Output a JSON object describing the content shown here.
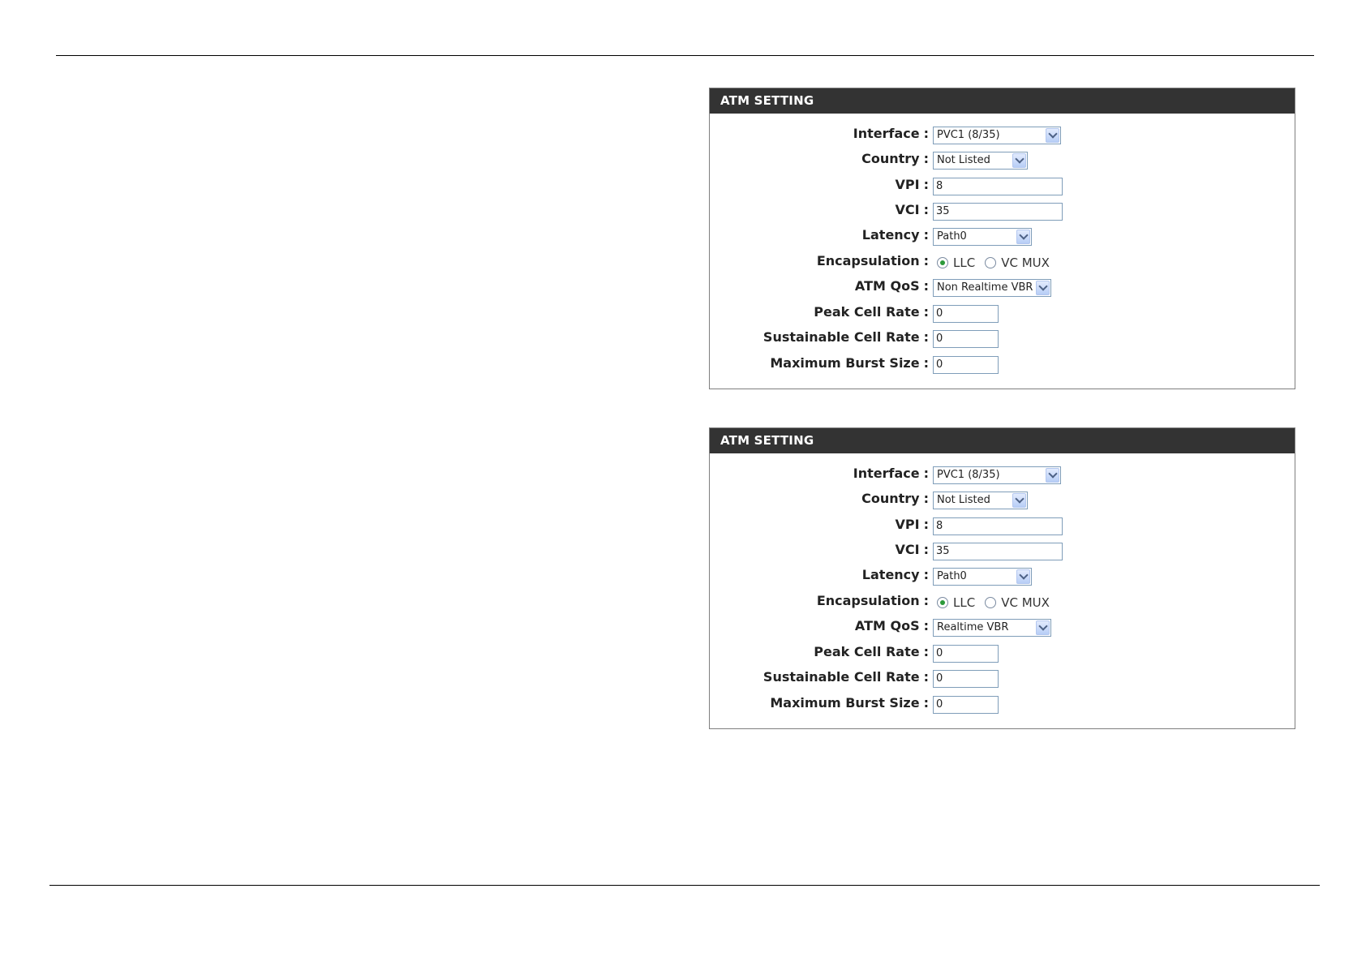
{
  "panels": [
    {
      "title": "ATM SETTING",
      "interface": {
        "label": "Interface",
        "value": "PVC1 (8/35)"
      },
      "country": {
        "label": "Country",
        "value": "Not Listed"
      },
      "vpi": {
        "label": "VPI",
        "value": "8"
      },
      "vci": {
        "label": "VCI",
        "value": "35"
      },
      "latency": {
        "label": "Latency",
        "value": "Path0"
      },
      "encapsulation": {
        "label": "Encapsulation",
        "option1": "LLC",
        "option2": "VC MUX",
        "selected": "LLC"
      },
      "atm_qos": {
        "label": "ATM QoS",
        "value": "Non Realtime VBR"
      },
      "peak_cell_rate": {
        "label": "Peak Cell Rate",
        "value": "0"
      },
      "sustainable_cell_rate": {
        "label": "Sustainable Cell Rate",
        "value": "0"
      },
      "max_burst_size": {
        "label": "Maximum Burst Size",
        "value": "0"
      }
    },
    {
      "title": "ATM SETTING",
      "interface": {
        "label": "Interface",
        "value": "PVC1 (8/35)"
      },
      "country": {
        "label": "Country",
        "value": "Not Listed"
      },
      "vpi": {
        "label": "VPI",
        "value": "8"
      },
      "vci": {
        "label": "VCI",
        "value": "35"
      },
      "latency": {
        "label": "Latency",
        "value": "Path0"
      },
      "encapsulation": {
        "label": "Encapsulation",
        "option1": "LLC",
        "option2": "VC MUX",
        "selected": "LLC"
      },
      "atm_qos": {
        "label": "ATM QoS",
        "value": "Realtime VBR"
      },
      "peak_cell_rate": {
        "label": "Peak Cell Rate",
        "value": "0"
      },
      "sustainable_cell_rate": {
        "label": "Sustainable Cell Rate",
        "value": "0"
      },
      "max_burst_size": {
        "label": "Maximum Burst Size",
        "value": "0"
      }
    }
  ],
  "colon": ":"
}
